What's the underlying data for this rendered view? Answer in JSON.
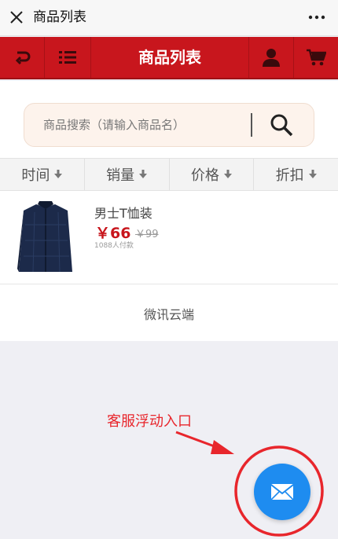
{
  "webview": {
    "title": "商品列表",
    "close_icon": "close-icon",
    "more_icon": "more-icon"
  },
  "header": {
    "title": "商品列表",
    "back_icon": "back-icon",
    "menu_icon": "list-menu-icon",
    "user_icon": "user-icon",
    "cart_icon": "cart-icon",
    "color": "#c8161d"
  },
  "search": {
    "placeholder": "商品搜索（请输入商品名）",
    "icon": "search-icon"
  },
  "sort": {
    "items": [
      {
        "label": "时间"
      },
      {
        "label": "销量"
      },
      {
        "label": "价格"
      },
      {
        "label": "折扣"
      }
    ]
  },
  "products": [
    {
      "name": "男士T恤装",
      "price": "￥66",
      "original_price": "￥99",
      "sold": "1088人付款"
    }
  ],
  "footer": {
    "text": "微讯云端"
  },
  "annotation": {
    "text": "客服浮动入口",
    "color": "#e8262c"
  },
  "float_button": {
    "icon": "mail-icon",
    "color": "#1e8cf0"
  }
}
